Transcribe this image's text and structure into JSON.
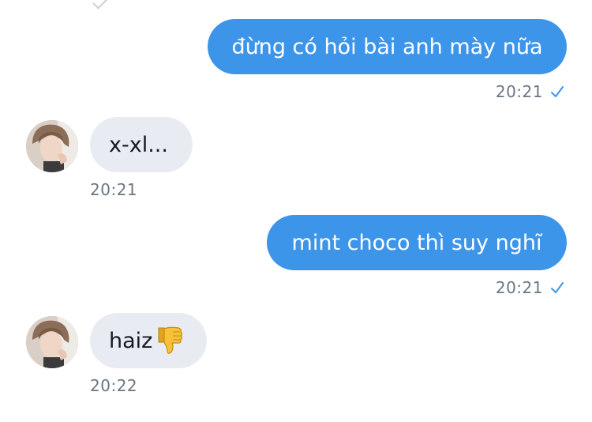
{
  "messages": [
    {
      "direction": "outgoing",
      "text": "đừng có hỏi bài anh mày nữa",
      "time": "20:21",
      "status_icon": "read-check-icon"
    },
    {
      "direction": "incoming",
      "text": "x-xl...",
      "time": "20:21",
      "avatar_icon": "contact-avatar"
    },
    {
      "direction": "outgoing",
      "text": "mint choco thì suy nghĩ",
      "time": "20:21",
      "status_icon": "read-check-icon"
    },
    {
      "direction": "incoming",
      "text": "haiz",
      "emoji_icon": "thumbs-down-icon",
      "time": "20:22",
      "avatar_icon": "contact-avatar"
    }
  ],
  "colors": {
    "outgoing_bubble": "#3d95ea",
    "incoming_bubble": "#e8ecf2",
    "time_text": "#6a7683",
    "check": "#3d95ea"
  }
}
